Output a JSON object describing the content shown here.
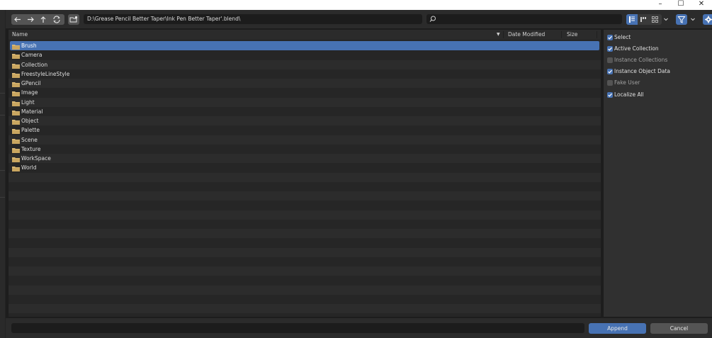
{
  "window": {
    "minimize_glyph": "–",
    "maximize_glyph": "☐",
    "close_glyph": "✕"
  },
  "toolbar": {
    "path": "D:\\Grease Pencil Better Taper\\Ink Pen Better Taper'.blend\\",
    "search_value": ""
  },
  "list": {
    "columns": {
      "name": "Name",
      "date_modified": "Date Modified",
      "size": "Size"
    },
    "sort_glyph": "▼",
    "items": [
      {
        "label": "Brush"
      },
      {
        "label": "Camera"
      },
      {
        "label": "Collection"
      },
      {
        "label": "FreestyleLineStyle"
      },
      {
        "label": "GPencil"
      },
      {
        "label": "Image"
      },
      {
        "label": "Light"
      },
      {
        "label": "Material"
      },
      {
        "label": "Object"
      },
      {
        "label": "Palette"
      },
      {
        "label": "Scene"
      },
      {
        "label": "Texture"
      },
      {
        "label": "WorkSpace"
      },
      {
        "label": "World"
      }
    ],
    "selected_index": 0
  },
  "options": [
    {
      "label": "Select",
      "checked": true
    },
    {
      "label": "Active Collection",
      "checked": true
    },
    {
      "label": "Instance Collections",
      "checked": false
    },
    {
      "label": "Instance Object Data",
      "checked": true
    },
    {
      "label": "Fake User",
      "checked": false
    },
    {
      "label": "Localize All",
      "checked": true
    }
  ],
  "bottom": {
    "filename_value": "",
    "append_label": "Append",
    "cancel_label": "Cancel"
  },
  "colors": {
    "accent": "#4772b3",
    "folder": "#d8b672",
    "background": "#1d1d1d"
  }
}
